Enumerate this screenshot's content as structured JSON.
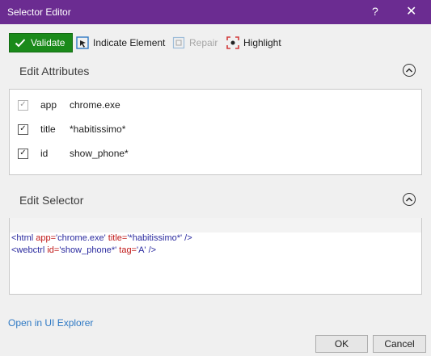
{
  "window": {
    "title": "Selector Editor",
    "help": "?",
    "close": "✕"
  },
  "toolbar": {
    "validate": "Validate",
    "indicate": "Indicate Element",
    "repair": "Repair",
    "highlight": "Highlight"
  },
  "attributes": {
    "header": "Edit Attributes",
    "rows": [
      {
        "name": "app",
        "value": "chrome.exe",
        "checked": true,
        "enabled": false
      },
      {
        "name": "title",
        "value": "*habitissimo*",
        "checked": true,
        "enabled": true
      },
      {
        "name": "id",
        "value": "show_phone*",
        "checked": true,
        "enabled": true
      }
    ]
  },
  "selector": {
    "header": "Edit Selector",
    "lines": [
      [
        {
          "t": "<html ",
          "c": "tag"
        },
        {
          "t": "app=",
          "c": "attr"
        },
        {
          "t": "'chrome.exe'",
          "c": "str"
        },
        {
          "t": " ",
          "c": "tag"
        },
        {
          "t": "title=",
          "c": "attr"
        },
        {
          "t": "'*habitissimo*'",
          "c": "str"
        },
        {
          "t": " />",
          "c": "tag"
        }
      ],
      [
        {
          "t": "<webctrl ",
          "c": "tag"
        },
        {
          "t": "id=",
          "c": "attr"
        },
        {
          "t": "'show_phone*'",
          "c": "str"
        },
        {
          "t": " ",
          "c": "tag"
        },
        {
          "t": "tag=",
          "c": "attr"
        },
        {
          "t": "'A'",
          "c": "str"
        },
        {
          "t": " />",
          "c": "tag"
        }
      ]
    ]
  },
  "footer": {
    "link": "Open in UI Explorer",
    "ok": "OK",
    "cancel": "Cancel"
  }
}
